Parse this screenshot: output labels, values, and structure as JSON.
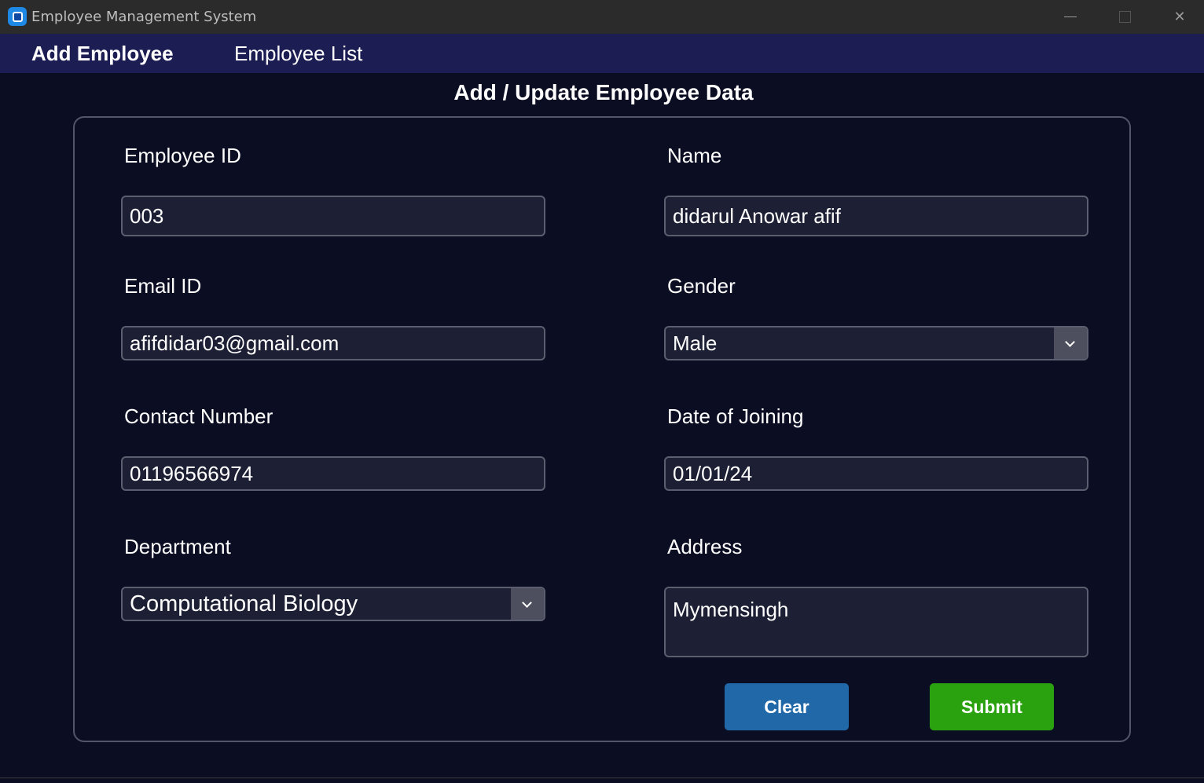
{
  "window": {
    "title": "Employee Management System"
  },
  "menu": {
    "items": [
      {
        "label": "Add Employee"
      },
      {
        "label": "Employee List"
      }
    ]
  },
  "page": {
    "title": "Add / Update Employee Data"
  },
  "form": {
    "employee_id": {
      "label": "Employee ID",
      "value": "003"
    },
    "name": {
      "label": "Name",
      "value": "didarul Anowar afif"
    },
    "email": {
      "label": "Email ID",
      "value": "afifdidar03@gmail.com"
    },
    "gender": {
      "label": "Gender",
      "value": "Male"
    },
    "contact": {
      "label": "Contact Number",
      "value": "01196566974"
    },
    "doj": {
      "label": "Date of Joining",
      "value": "01/01/24"
    },
    "department": {
      "label": "Department",
      "value": "Computational Biology"
    },
    "address": {
      "label": "Address",
      "value": "Mymensingh"
    }
  },
  "buttons": {
    "clear": "Clear",
    "submit": "Submit"
  },
  "colors": {
    "background": "#0b0d22",
    "menubar": "#1c1d52",
    "clear_button": "#2068a8",
    "submit_button": "#2aa10f"
  }
}
